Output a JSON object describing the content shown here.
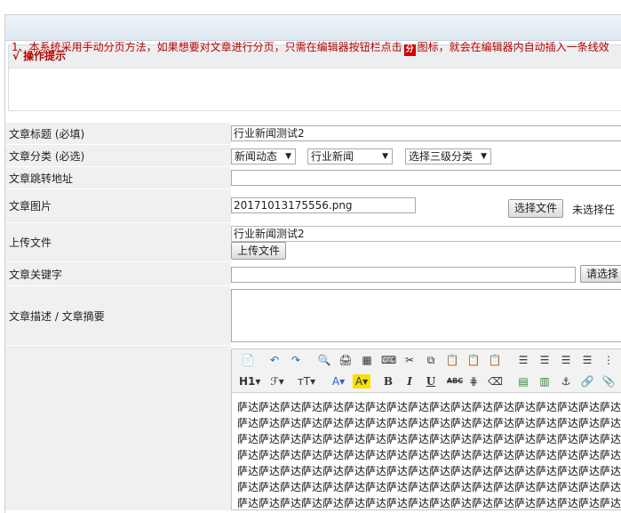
{
  "tips": {
    "heading": "√ 操作提示",
    "line_before": "1、本系统采用手动分页方法，如果想要对文章进行分页，只需在编辑器按钮栏点击",
    "icon_text": "分",
    "line_after": "图标，就会在编辑器内自动插入一条线效"
  },
  "form": {
    "title_label": "文章标题 (必填)",
    "title_value": "行业新闻测试2",
    "category_label": "文章分类 (必选)",
    "cat1": "新闻动态",
    "cat2": "行业新闻",
    "cat3": "选择三级分类",
    "redirect_label": "文章跳转地址",
    "image_label": "文章图片",
    "image_value": "20171013175556.png",
    "choose_file": "选择文件",
    "no_file": "未选择任",
    "upload_label": "上传文件",
    "upload_value": "行业新闻测试2",
    "upload_button": "上传文件",
    "keywords_label": "文章关键字",
    "keywords_button": "请选择",
    "desc_label": "文章描述 / 文章摘要"
  },
  "editor": {
    "toolbar2": {
      "heading": "H1",
      "font_family": "ℱ",
      "font_size": "тT",
      "font_color": "A",
      "bg_color": "A",
      "bold": "B",
      "italic": "I",
      "underline": "U",
      "strike": "ABC"
    },
    "content_lines": [
      "萨达萨达萨达萨达萨达萨达萨达萨达萨达萨达萨达萨达萨达萨达萨达萨达萨达萨达",
      "萨达萨达萨达萨达萨达萨达萨达萨达萨达萨达萨达萨达萨达萨达萨达萨达萨达萨达",
      "萨达萨达萨达萨达萨达萨达萨达萨达萨达萨达萨达萨达萨达萨达萨达萨达萨达萨达",
      "萨达萨达萨达萨达萨达萨达萨达萨达萨达萨达萨达萨达萨达萨达萨达萨达萨达萨达",
      "萨达萨达萨达萨达萨达萨达萨达萨达萨达萨达萨达萨达萨达萨达萨达萨达萨达萨达",
      "萨达萨达萨达萨达萨达萨达萨达萨达萨达萨达萨达萨达萨达萨达萨达萨达萨达萨达",
      "萨达萨达萨达萨达萨达萨达萨达萨达萨达萨达萨达萨达萨达萨达萨达萨达萨达萨达"
    ]
  }
}
